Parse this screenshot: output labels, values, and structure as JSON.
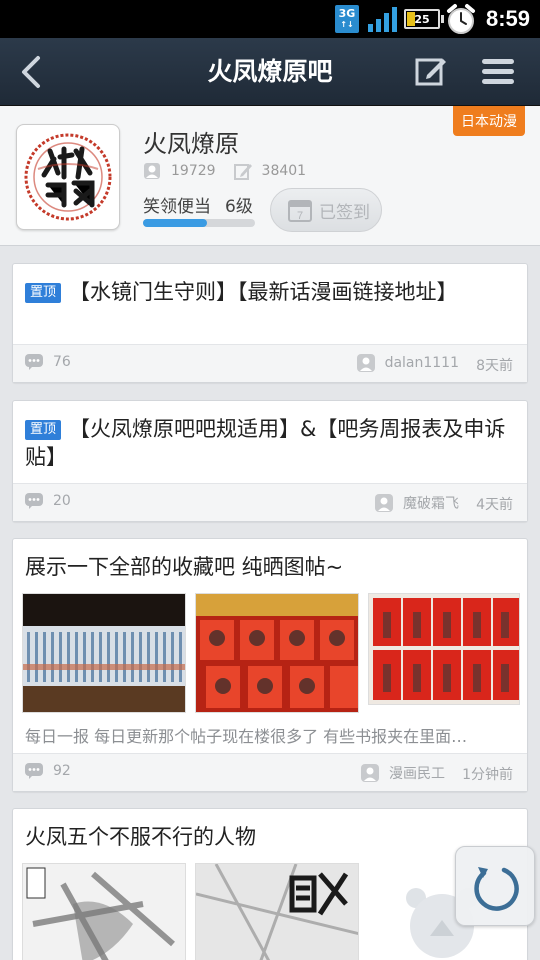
{
  "status_bar": {
    "network": "3G",
    "battery": "25",
    "time": "8:59",
    "icons": [
      "3g-icon",
      "signal-icon",
      "battery-icon",
      "alarm-clock-icon"
    ]
  },
  "title_bar": {
    "title": "火凤燎原吧",
    "icons": [
      "back-arrow-icon",
      "compose-icon",
      "menu-icon"
    ]
  },
  "forum": {
    "name": "火凤燎原",
    "tag": "日本动漫",
    "members": "19729",
    "posts": "38401",
    "rank_title": "笑领便当",
    "level": "6级",
    "level_progress": 0.57,
    "signin_label": "已签到"
  },
  "posts": [
    {
      "pinned_label": "置顶",
      "title": "【水镜门生守则】【最新话漫画链接地址】",
      "comments": "76",
      "author": "dalan1111",
      "time": "8天前"
    },
    {
      "pinned_label": "置顶",
      "title": "【火凤燎原吧吧规适用】&【吧务周报表及申诉贴】",
      "comments": "20",
      "author": "魔破霜飞",
      "time": "4天前"
    },
    {
      "title": "展示一下全部的收藏吧 纯晒图帖~",
      "excerpt": "每日一报 每日更新那个帖子现在楼很多了 有些书报夹在里面…",
      "comments": "92",
      "author": "漫画民工",
      "time": "1分钟前"
    },
    {
      "title": "火凤五个不服不行的人物"
    }
  ],
  "colors": {
    "accent_blue": "#2f7fd9",
    "tag_orange": "#ef7d1e",
    "titlebar": "#26323f"
  }
}
